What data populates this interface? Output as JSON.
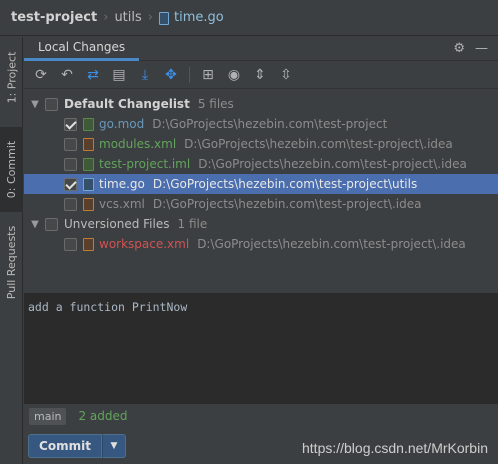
{
  "breadcrumb": {
    "project": "test-project",
    "folder": "utils",
    "file": "time.go"
  },
  "sidebar": {
    "tabs": [
      {
        "label": "1: Project"
      },
      {
        "label": "0: Commit"
      },
      {
        "label": "Pull Requests"
      }
    ]
  },
  "panel": {
    "tab_label": "Local Changes",
    "tools": {
      "settings_icon": "gear-icon",
      "hide_icon": "minimize-icon"
    }
  },
  "toolbar": {
    "icons": [
      "refresh-icon",
      "rollback-icon",
      "diff-icon",
      "changelist-icon",
      "shelve-icon",
      "group-icon",
      "view-options-icon",
      "eye-icon",
      "expand-all-icon",
      "collapse-all-icon"
    ]
  },
  "tree": {
    "default_group": {
      "label": "Default Changelist",
      "count": "5 files"
    },
    "files": [
      {
        "name": "go.mod",
        "path": "D:\\GoProjects\\hezebin.com\\test-project"
      },
      {
        "name": "modules.xml",
        "path": "D:\\GoProjects\\hezebin.com\\test-project\\.idea"
      },
      {
        "name": "test-project.iml",
        "path": "D:\\GoProjects\\hezebin.com\\test-project\\.idea"
      },
      {
        "name": "time.go",
        "path": "D:\\GoProjects\\hezebin.com\\test-project\\utils"
      },
      {
        "name": "vcs.xml",
        "path": "D:\\GoProjects\\hezebin.com\\test-project\\.idea"
      }
    ],
    "unversioned_group": {
      "label": "Unversioned Files",
      "count": "1 file"
    },
    "unversioned_files": [
      {
        "name": "workspace.xml",
        "path": "D:\\GoProjects\\hezebin.com\\test-project\\.idea"
      }
    ]
  },
  "commit_message": "add a function PrintNow",
  "status": {
    "branch": "main",
    "added": "2 added"
  },
  "actions": {
    "commit_label": "Commit"
  },
  "watermark": "https://blog.csdn.net/MrKorbin",
  "colors": {
    "accent": "#4b6eaf",
    "button": "#365880",
    "added": "#62a35c",
    "unversioned": "#d25252"
  }
}
